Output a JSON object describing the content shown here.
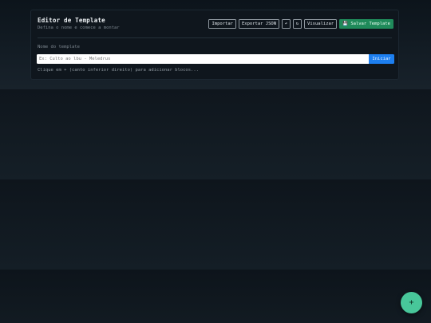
{
  "header": {
    "title": "Editor de Template",
    "subtitle": "Defina o nome e comece a montar"
  },
  "toolbar": {
    "import_label": "Importar",
    "export_label": "Exportar JSON",
    "undo_icon": "↶",
    "redo_icon": "↻",
    "preview_label": "Visualizar",
    "save_label": "💾 Salvar Template"
  },
  "form": {
    "name_label": "Nome do template",
    "name_placeholder": "Ex: Culto ao lbu - Meledrus",
    "start_label": "Iniciar",
    "hint": "Clique em + (canto inferior direito) para adicionar blocos..."
  },
  "fab": {
    "label": "+"
  },
  "colors": {
    "save_button": "#1f8a5a",
    "start_button": "#1d7ff0",
    "fab": "#48c79a"
  }
}
